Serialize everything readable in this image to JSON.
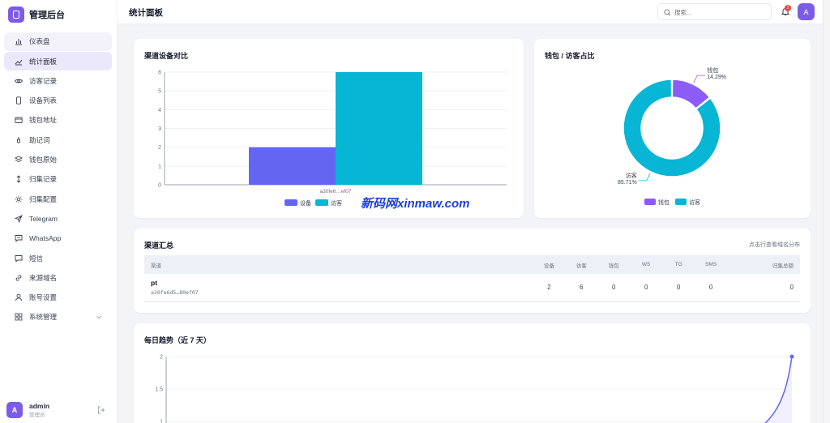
{
  "brand": {
    "title": "管理后台"
  },
  "sidebar": {
    "items": [
      {
        "label": "仪表盘",
        "icon": "bar-chart-icon"
      },
      {
        "label": "统计面板",
        "icon": "trend-line-icon"
      },
      {
        "label": "访客记录",
        "icon": "eye-icon"
      },
      {
        "label": "设备列表",
        "icon": "phone-icon"
      },
      {
        "label": "钱包地址",
        "icon": "wallet-icon"
      },
      {
        "label": "助记词",
        "icon": "key-icon"
      },
      {
        "label": "钱包原始",
        "icon": "layers-icon"
      },
      {
        "label": "归集记录",
        "icon": "arrows-vertical-icon"
      },
      {
        "label": "归集配置",
        "icon": "sun-gear-icon"
      },
      {
        "label": "Telegram",
        "icon": "send-icon"
      },
      {
        "label": "WhatsApp",
        "icon": "chat-icon"
      },
      {
        "label": "短信",
        "icon": "message-icon"
      },
      {
        "label": "来源域名",
        "icon": "link-icon"
      },
      {
        "label": "账号设置",
        "icon": "user-icon"
      },
      {
        "label": "系统管理",
        "icon": "grid-icon"
      }
    ]
  },
  "user": {
    "avatar": "A",
    "name": "admin",
    "role": "管理员"
  },
  "topbar": {
    "title": "统计面板",
    "search_placeholder": "搜索...",
    "notification_count": "2",
    "avatar": "A"
  },
  "channel_chart": {
    "title": "渠道设备对比"
  },
  "wallet_chart": {
    "title": "钱包 / 访客占比"
  },
  "summary": {
    "title": "渠道汇总",
    "link": "点击行查看域名分布",
    "columns": [
      "渠道",
      "设备",
      "访客",
      "钱包",
      "WS",
      "TG",
      "SMS",
      "归集总额"
    ],
    "rows": [
      {
        "name": "pt",
        "id": "a30fe6d5…80ef07",
        "devices": "2",
        "visitors": "6",
        "wallets": "0",
        "ws": "0",
        "tg": "0",
        "sms": "0",
        "total": "0"
      }
    ]
  },
  "trend": {
    "title": "每日趋势（近 7 天）"
  },
  "watermark": "新码网xinmaw.com",
  "colors": {
    "accent": "#7c5ce6",
    "devices": "#6366f1",
    "visitors": "#06b6d4",
    "wallets": "#8b5cf6"
  },
  "chart_data": [
    {
      "type": "bar",
      "title": "渠道设备对比",
      "categories": [
        "a30fe6…ef07"
      ],
      "series": [
        {
          "name": "设备",
          "values": [
            2
          ]
        },
        {
          "name": "访客",
          "values": [
            6
          ]
        }
      ],
      "ylim": [
        0,
        6
      ],
      "yticks": [
        "0",
        "1",
        "2",
        "3",
        "4",
        "5",
        "6"
      ],
      "legend": "bottom"
    },
    {
      "type": "pie",
      "title": "钱包 / 访客占比",
      "donut": true,
      "slices": [
        {
          "name": "钱包",
          "value": 1,
          "percent": "14.29%"
        },
        {
          "name": "访客",
          "value": 6,
          "percent": "85.71%"
        }
      ],
      "legend": "bottom"
    },
    {
      "type": "line",
      "title": "每日趋势（近 7 天）",
      "yticks": [
        "2",
        "1.5",
        "1"
      ],
      "series": [
        {
          "values": [
            0,
            0,
            0,
            0,
            0,
            0,
            2
          ]
        }
      ]
    }
  ]
}
